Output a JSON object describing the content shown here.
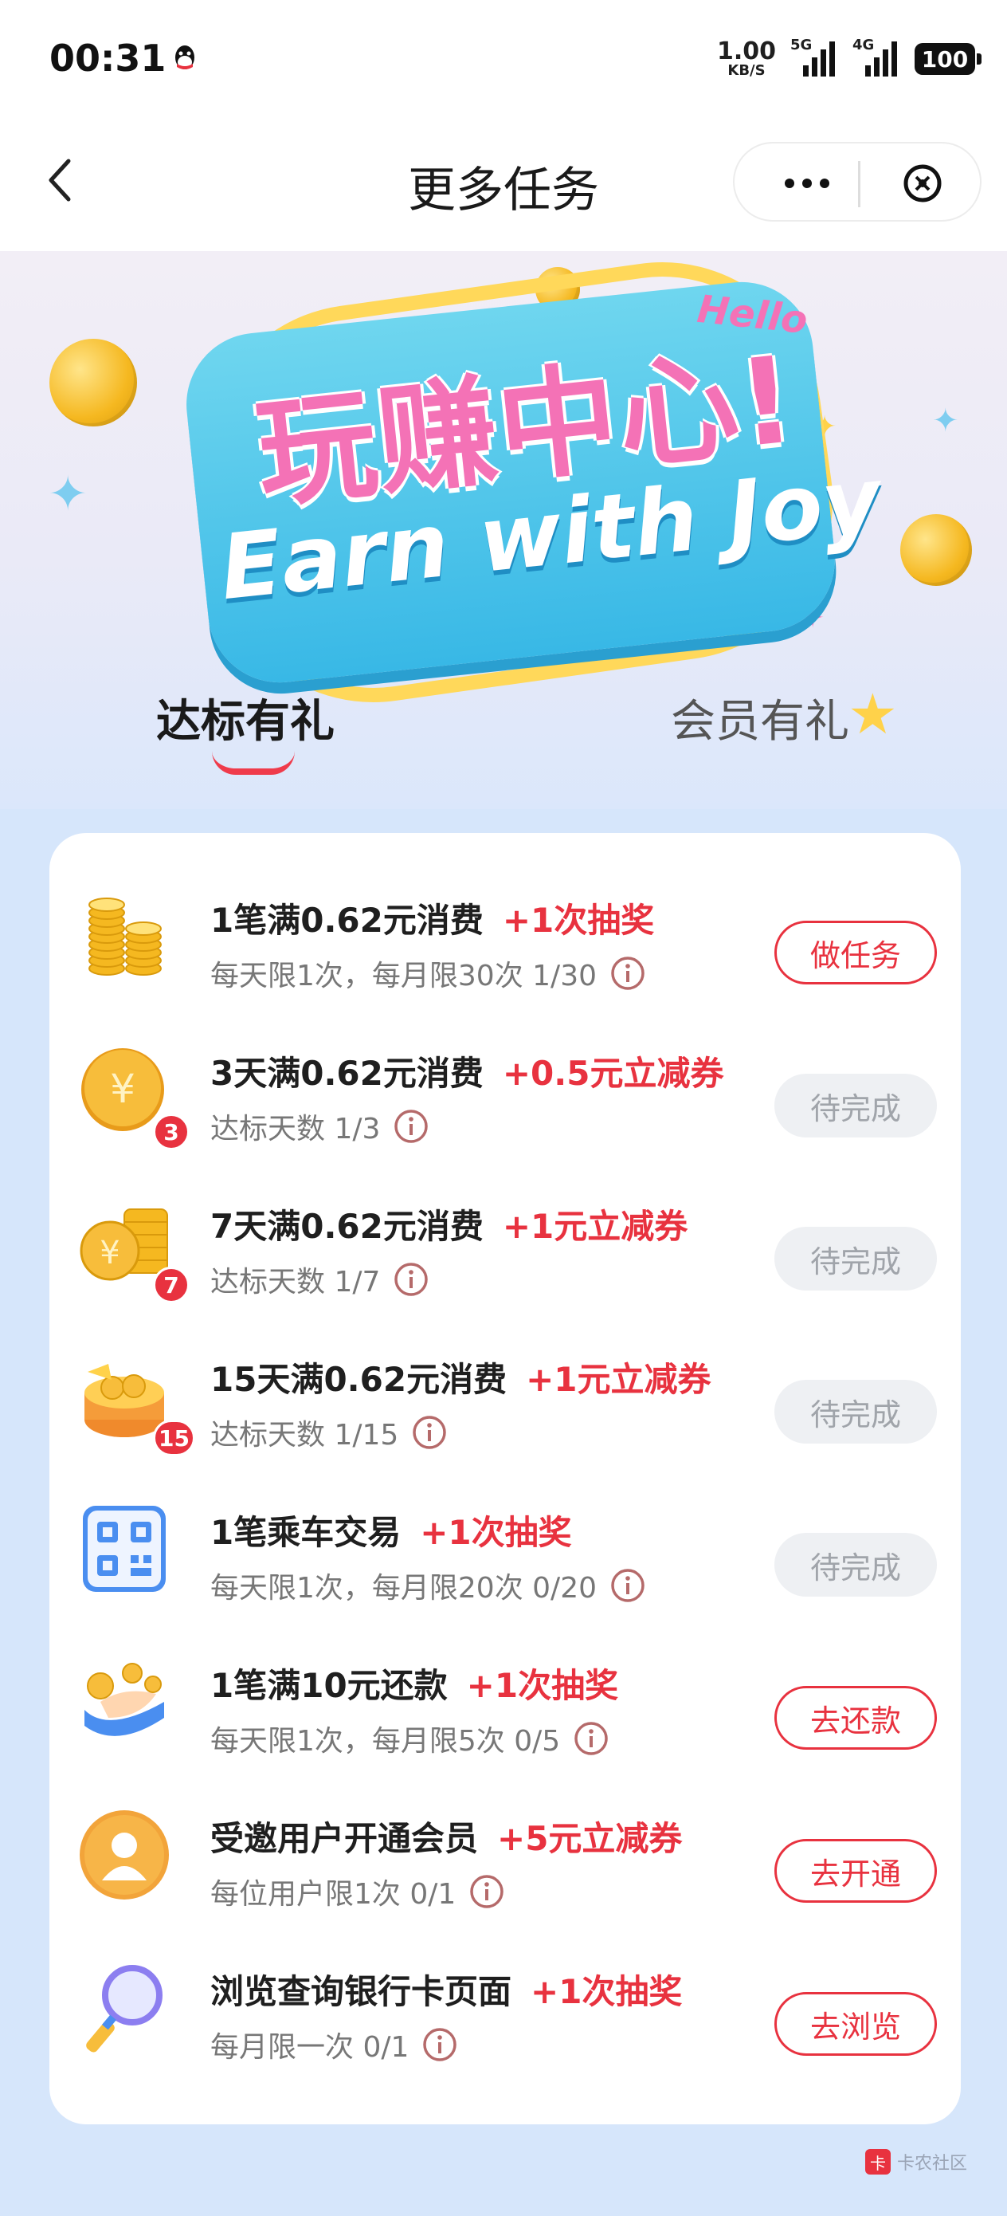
{
  "status_bar": {
    "time": "00:31",
    "net_speed_value": "1.00",
    "net_speed_unit": "KB/S",
    "sim1": "5G",
    "sim2": "4G",
    "battery": "100"
  },
  "nav": {
    "title": "更多任务"
  },
  "banner": {
    "title_cn": "玩赚中心!",
    "title_en": "Earn with Joy",
    "hello": "Hello"
  },
  "tabs": [
    {
      "label": "达标有礼",
      "active": true
    },
    {
      "label": "会员有礼",
      "active": false
    }
  ],
  "tasks": [
    {
      "title": "1笔满0.62元消费",
      "reward": "+1次抽奖",
      "subtitle": "每天限1次，每月限30次  1/30",
      "button": "做任务",
      "state": "action",
      "icon": "gold-coins-stack-icon",
      "badge": ""
    },
    {
      "title": "3天满0.62元消费",
      "reward": "+0.5元立减券",
      "subtitle": "达标天数  1/3",
      "button": "待完成",
      "state": "pending",
      "icon": "yuan-coin-icon",
      "badge": "3"
    },
    {
      "title": "7天满0.62元消费",
      "reward": "+1元立减券",
      "subtitle": "达标天数  1/7",
      "button": "待完成",
      "state": "pending",
      "icon": "coin-stack-icon",
      "badge": "7"
    },
    {
      "title": "15天满0.62元消费",
      "reward": "+1元立减券",
      "subtitle": "达标天数  1/15",
      "button": "待完成",
      "state": "pending",
      "icon": "treasure-box-icon",
      "badge": "15"
    },
    {
      "title": "1笔乘车交易",
      "reward": "+1次抽奖",
      "subtitle": "每天限1次，每月限20次  0/20",
      "button": "待完成",
      "state": "pending",
      "icon": "qr-code-icon",
      "badge": ""
    },
    {
      "title": "1笔满10元还款",
      "reward": "+1次抽奖",
      "subtitle": "每天限1次，每月限5次  0/5",
      "button": "去还款",
      "state": "action",
      "icon": "hand-coins-icon",
      "badge": ""
    },
    {
      "title": "受邀用户开通会员",
      "reward": "+5元立减券",
      "subtitle": "每位用户限1次  0/1",
      "button": "去开通",
      "state": "action",
      "icon": "user-avatar-icon",
      "badge": ""
    },
    {
      "title": "浏览查询银行卡页面",
      "reward": "+1次抽奖",
      "subtitle": "每月限一次  0/1",
      "button": "去浏览",
      "state": "action",
      "icon": "magnifier-icon",
      "badge": ""
    }
  ],
  "watermark": {
    "text": "卡农社区"
  },
  "colors": {
    "accent_red": "#e8323f",
    "page_bg": "#d6e6fb",
    "pending_bg": "#eef0f3"
  }
}
